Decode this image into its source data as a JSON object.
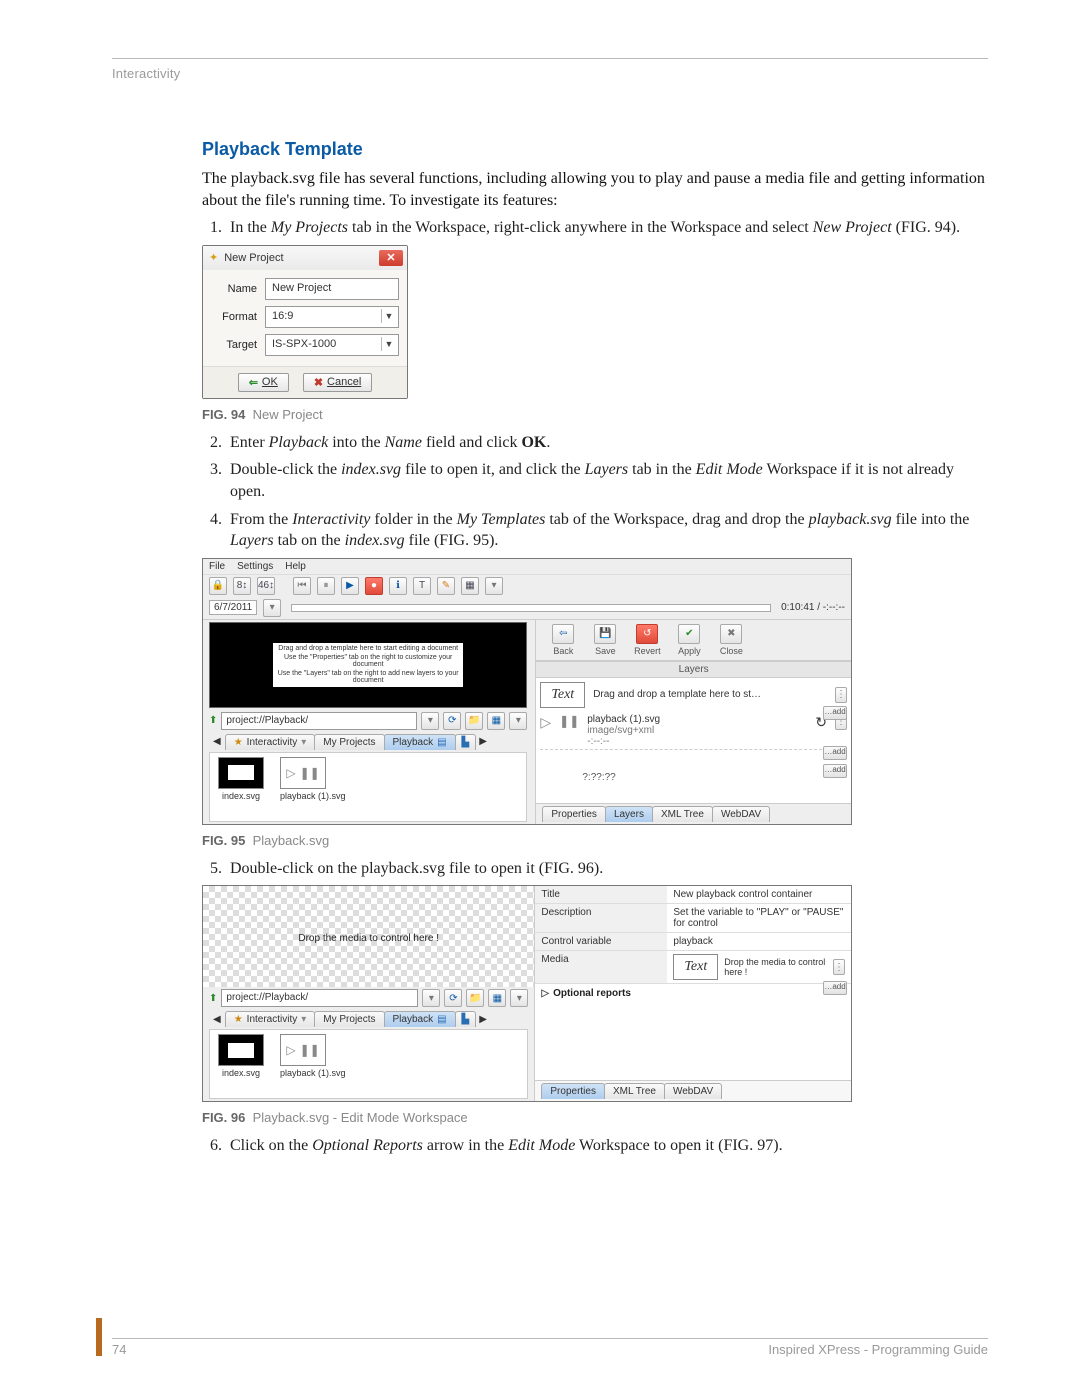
{
  "header": {
    "section": "Interactivity"
  },
  "title": "Playback Template",
  "intro": "The playback.svg file has several functions, including allowing you to play and pause a media file and getting information about the file's running time. To investigate its features:",
  "steps": {
    "s1a": "In the ",
    "s1b": "My Projects",
    "s1c": " tab in the Workspace, right-click anywhere in the Workspace and select ",
    "s1d": "New Project",
    "s1e": " (FIG. 94).",
    "s2a": "Enter ",
    "s2b": "Playback",
    "s2c": " into the ",
    "s2d": "Name",
    "s2e": " field and click ",
    "s2f": "OK",
    "s2g": ".",
    "s3a": "Double-click the ",
    "s3b": "index.svg",
    "s3c": " file to open it, and click the ",
    "s3d": "Layers",
    "s3e": " tab in the ",
    "s3f": "Edit Mode",
    "s3g": " Workspace if it is not already open.",
    "s4a": "From the ",
    "s4b": "Interactivity",
    "s4c": " folder in the ",
    "s4d": "My Templates",
    "s4e": " tab of the Workspace, drag and drop the ",
    "s4f": "playback.svg",
    "s4g": " file into the ",
    "s4h": "Layers",
    "s4i": " tab on the ",
    "s4j": "index.svg",
    "s4k": " file (FIG. 95).",
    "s5": "Double-click on the playback.svg file to open it (FIG. 96).",
    "s6a": "Click on the ",
    "s6b": "Optional Reports",
    "s6c": " arrow in the ",
    "s6d": "Edit Mode",
    "s6e": " Workspace to open it (FIG. 97)."
  },
  "fig94": {
    "caption_bold": "FIG. 94",
    "caption": "New Project",
    "title": "New Project",
    "name_lbl": "Name",
    "name_val": "New Project",
    "format_lbl": "Format",
    "format_val": "16:9",
    "target_lbl": "Target",
    "target_val": "IS-SPX-1000",
    "ok": "OK",
    "cancel": "Cancel"
  },
  "fig95": {
    "caption_bold": "FIG. 95",
    "caption": "Playback.svg",
    "menu": {
      "file": "File",
      "settings": "Settings",
      "help": "Help"
    },
    "date": "6/7/2011",
    "time": "0:10:41 / -:--:--",
    "preview": {
      "l1": "Drag and drop a template here to start editing a document",
      "l2": "Use the \"Properties\" tab on the right to customize your document",
      "l3": "Use the \"Layers\" tab on the right to add new layers to your document"
    },
    "path": "project://Playback/",
    "tabs": {
      "t1": "Interactivity",
      "t2": "My Projects",
      "t3": "Playback"
    },
    "thumbs": {
      "idx": "index.svg",
      "pb": "playback (1).svg"
    },
    "toolbar": {
      "back": "Back",
      "save": "Save",
      "revert": "Revert",
      "apply": "Apply",
      "close": "Close"
    },
    "layers_hdr": "Layers",
    "drop_hint": "Drag and drop a template here to st…",
    "textbox": "Text",
    "layer": {
      "name": "playback (1).svg",
      "mime": "image/svg+xml",
      "dur1": "-:--:--",
      "dur2": "?:??:??"
    },
    "bottomtabs": {
      "a": "Properties",
      "b": "Layers",
      "c": "XML Tree",
      "d": "WebDAV"
    },
    "addbtn": "…add"
  },
  "fig96": {
    "caption_bold": "FIG. 96",
    "caption": "Playback.svg - Edit Mode Workspace",
    "dropmsg": "Drop the media to control here !",
    "path": "project://Playback/",
    "tabs": {
      "t1": "Interactivity",
      "t2": "My Projects",
      "t3": "Playback"
    },
    "thumbs": {
      "idx": "index.svg",
      "pb": "playback (1).svg"
    },
    "props": {
      "title_k": "Title",
      "title_v": "New playback control container",
      "desc_k": "Description",
      "desc_v": "Set the variable to \"PLAY\" or \"PAUSE\" for control",
      "cv_k": "Control variable",
      "cv_v": "playback",
      "media_k": "Media",
      "media_hint": "Drop the media to control here !",
      "media_text": "Text",
      "opt": "Optional reports"
    },
    "bottomtabs": {
      "a": "Properties",
      "b": "XML Tree",
      "c": "WebDAV"
    },
    "addbtn": "…add"
  },
  "footer": {
    "page": "74",
    "doc": "Inspired XPress - Programming Guide"
  }
}
